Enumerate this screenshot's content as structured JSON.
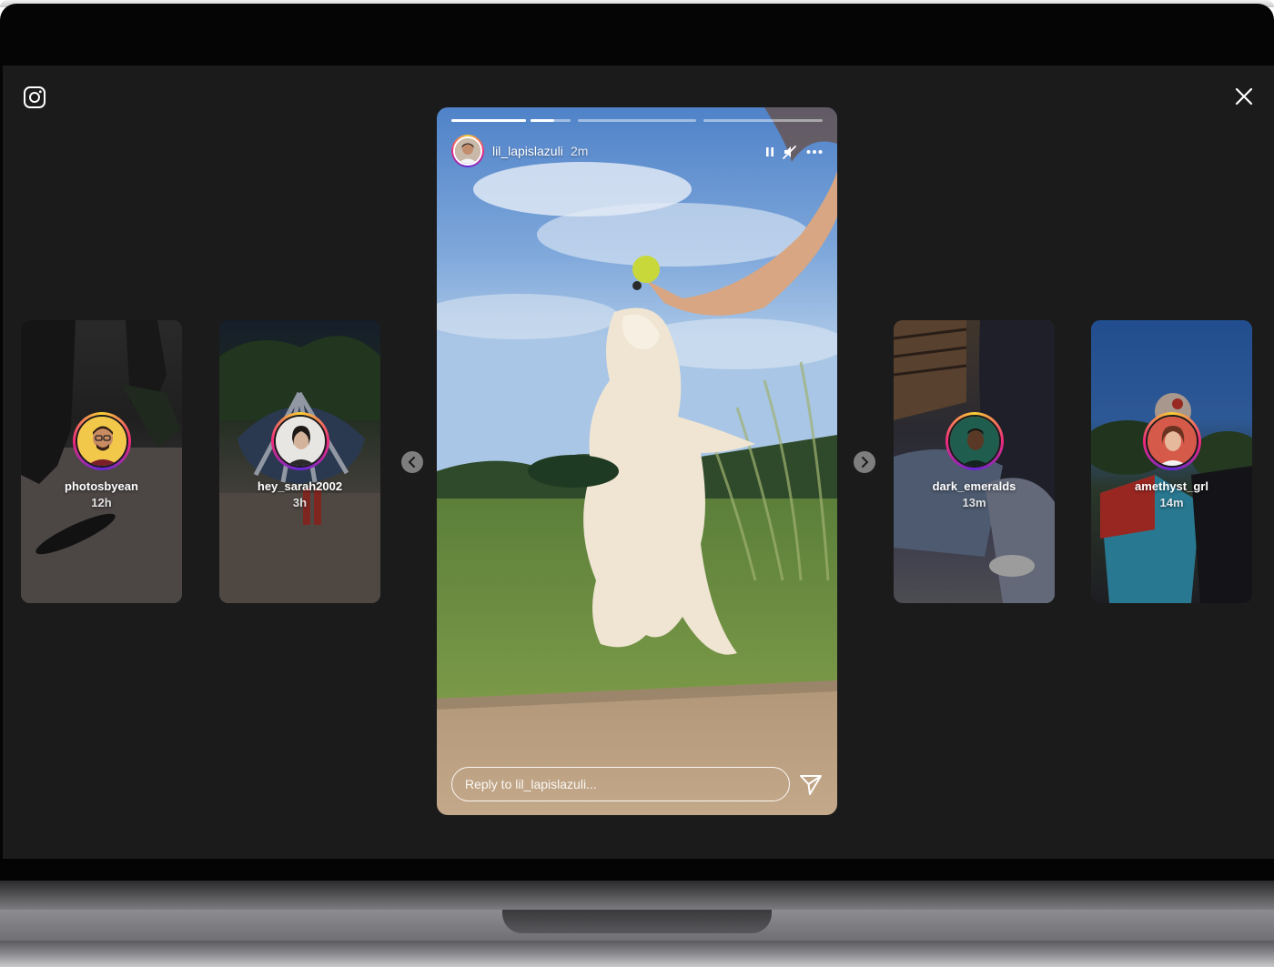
{
  "app": {
    "logo_icon": "instagram-logo-icon",
    "close_icon": "close-icon"
  },
  "story": {
    "username": "lil_lapislazuli",
    "time": "2m",
    "segments": 4,
    "active_segment": 1,
    "active_progress": 0.6,
    "controls": [
      "pause-icon",
      "mute-icon",
      "more-options-icon"
    ],
    "reply_placeholder": "Reply to lil_lapislazuli...",
    "send_icon": "send-icon"
  },
  "tray_left": [
    {
      "username": "photosbyean",
      "time": "12h"
    },
    {
      "username": "hey_sarah2002",
      "time": "3h"
    }
  ],
  "tray_right": [
    {
      "username": "dark_emeralds",
      "time": "13m"
    },
    {
      "username": "amethyst_grl",
      "time": "14m"
    }
  ],
  "nav": {
    "prev_icon": "chevron-left-icon",
    "next_icon": "chevron-right-icon"
  },
  "colors": {
    "background": "#1b1b1b",
    "ring_gradient": [
      "#f9ce34",
      "#ee2a7b",
      "#6228d7"
    ]
  }
}
